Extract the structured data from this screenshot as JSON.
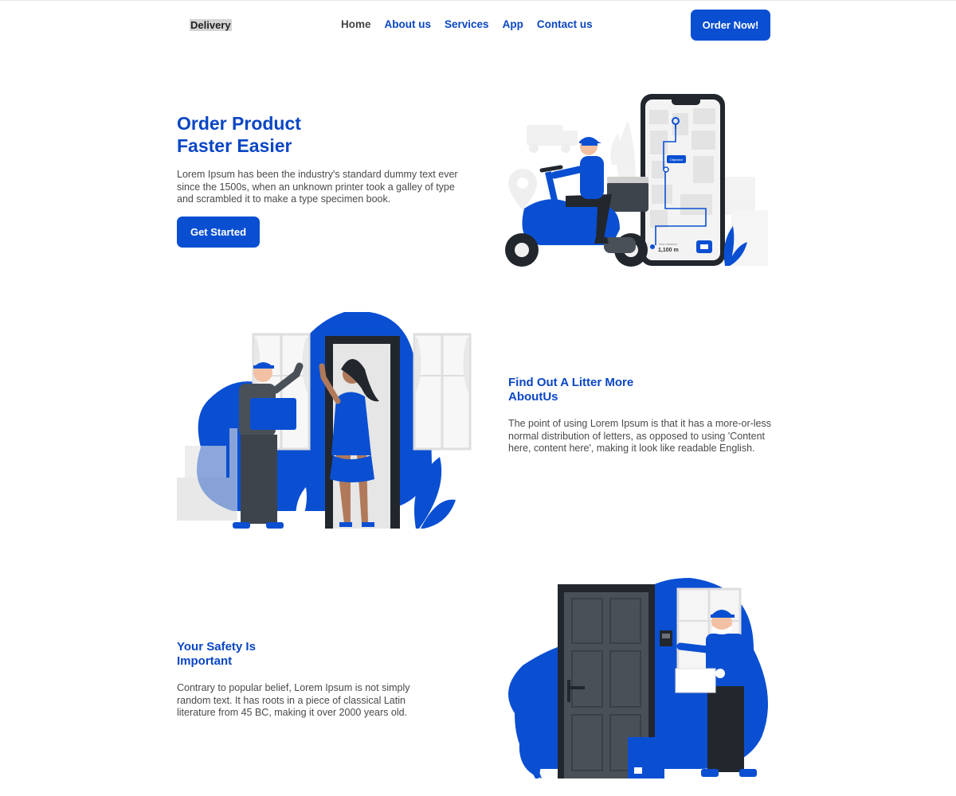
{
  "nav": {
    "logo": "Delivery",
    "links": [
      "Home",
      "About us",
      "Services",
      "App",
      "Contact us"
    ],
    "order_button": "Order Now!"
  },
  "hero": {
    "title_line1": "Order Product",
    "title_line2": "Faster Easier",
    "text": "Lorem Ipsum has been the industry's standard dummy text ever since the 1500s, when an unknown printer took a galley of type and scrambled it to make a type specimen book.",
    "button": "Get Started",
    "map_tag": "Objective",
    "distance_label": "Total distance",
    "distance_value": "1,100 m"
  },
  "about": {
    "title_line1": "Find Out A Litter More",
    "title_line2": "AboutUs",
    "text": "The point of using Lorem Ipsum is that it has a more-or-less normal distribution of letters, as opposed to using 'Content here, content here', making it look like readable English."
  },
  "safety": {
    "title_line1": "Your Safety Is",
    "title_line2": "Important",
    "text": "Contrary to popular belief, Lorem Ipsum is not simply random text. It has roots in a piece of classical Latin literature from 45 BC, making it over 2000 years old."
  },
  "colors": {
    "brand_blue": "#0a4fd2",
    "heading_blue": "#0a46c4",
    "dark": "#2a2f36"
  }
}
